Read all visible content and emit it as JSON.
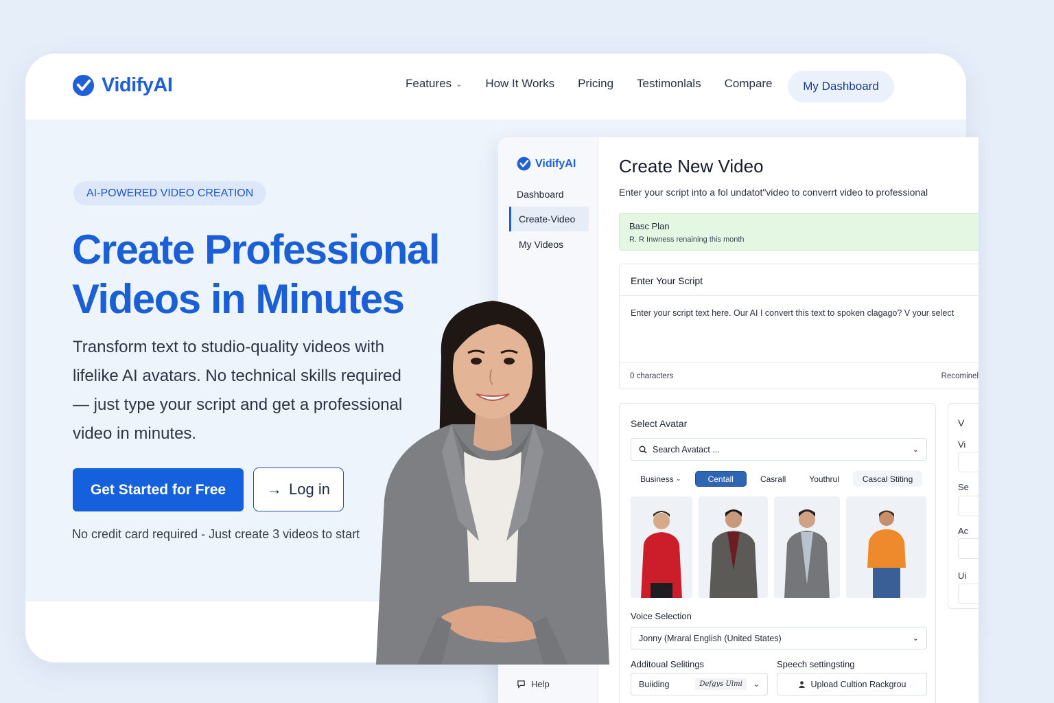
{
  "brand": {
    "name": "VidifyAI",
    "accent": "#1f5fd8"
  },
  "nav": {
    "items": [
      "Features",
      "How It Works",
      "Pricing",
      "Testimonlals",
      "Compare"
    ],
    "dashboard": "My Dashboard"
  },
  "hero": {
    "badge": "AI-POWERED VIDEO CREATION",
    "title_line1": "Create Professional",
    "title_line2": "Videos in Minutes",
    "lead_line1": "Transform text to studio-quality videos with",
    "lead_line2": "lifelike AI avatars. No technical skills required",
    "lead_line3": "— just type your script and get a professional",
    "lead_line4": "video in minutes.",
    "cta": "Get Started for Free",
    "login": "Log in",
    "note": "No credit card required - Just create 3 videos to start"
  },
  "app": {
    "logo": "VidifyAI",
    "sidebar": [
      "Dashboard",
      "Create-Video",
      "My Videos"
    ],
    "help": "Help",
    "title": "Create New Video",
    "subtitle": "Enter your script into a  fol undatot\"video to converrt video to professional",
    "plan": {
      "name": "Basc Plan",
      "detail": "R. R Inwness renaining this month"
    },
    "script": {
      "header": "Enter Your Script",
      "placeholder": "Enter your script text here. Our AI I convert this text to spoken clagago?  V your select",
      "count": "0 characters",
      "right": "Recominel"
    },
    "avatar": {
      "header": "Select Avatar",
      "search": "Search Avatact ...",
      "chips": [
        "Business",
        "Centall",
        "Casrall",
        "Youthrul",
        "Cascal Stiting"
      ]
    },
    "voice": {
      "label": "Voice Selection",
      "value": "Jonny (Mraral English (United States)"
    },
    "additional": {
      "label": "Additoual Selitings",
      "value": "Buiiding",
      "script_text": "Defgys Ulmi"
    },
    "speech": {
      "label": "Speech settingsting",
      "button": "Upload Cultion Rackgrou"
    },
    "side_panel": {
      "v": "V",
      "vi": "Vi",
      "se": "Se",
      "ac": "Ac",
      "ui": "Ui"
    }
  }
}
